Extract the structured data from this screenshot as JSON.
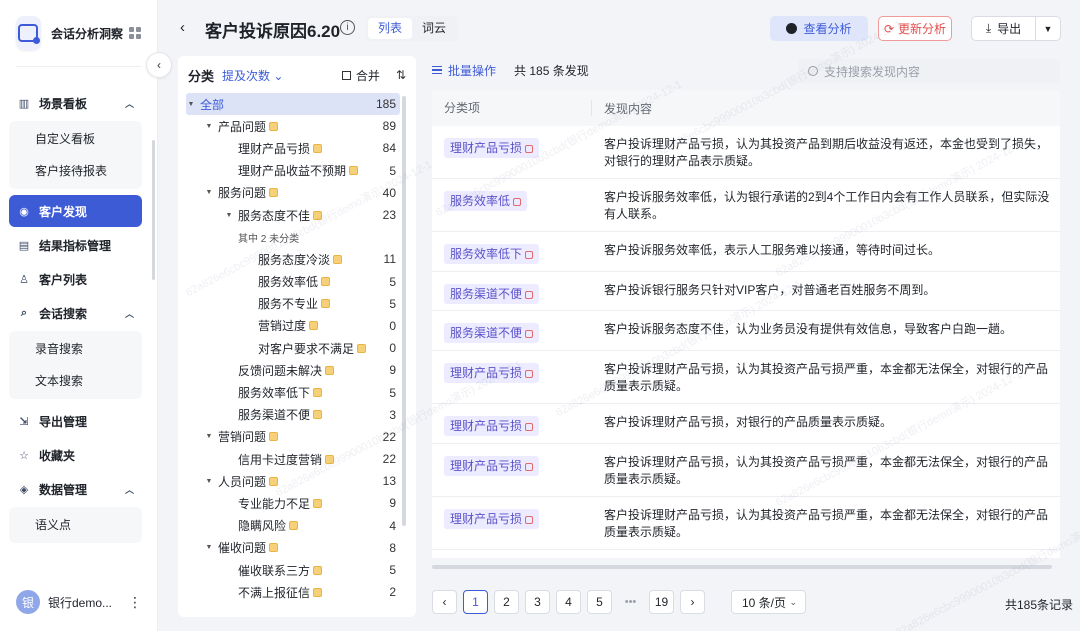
{
  "brand": {
    "name": "会话分析洞察"
  },
  "sidebar": {
    "groups": [
      {
        "label": "场景看板",
        "icon": "chart-icon",
        "expanded": true,
        "children": [
          "自定义看板",
          "客户接待报表"
        ]
      },
      {
        "label": "客户发现",
        "icon": "discovery-icon",
        "active": true
      },
      {
        "label": "结果指标管理",
        "icon": "doc-icon"
      },
      {
        "label": "客户列表",
        "icon": "user-icon"
      },
      {
        "label": "会话搜索",
        "icon": "search-doc-icon",
        "expanded": true,
        "children": [
          "录音搜索",
          "文本搜索"
        ]
      },
      {
        "label": "导出管理",
        "icon": "export-icon"
      },
      {
        "label": "收藏夹",
        "icon": "star-icon"
      },
      {
        "label": "数据管理",
        "icon": "layers-icon",
        "expanded": true,
        "children": [
          "语义点"
        ]
      }
    ],
    "user": {
      "avatar": "银",
      "name": "银行demo..."
    }
  },
  "header": {
    "title": "客户投诉原因6.20",
    "tabs": [
      "列表",
      "词云"
    ],
    "active_tab": "列表",
    "analyze": "查看分析",
    "update": "更新分析",
    "export": "导出"
  },
  "category": {
    "title": "分类",
    "sort": "提及次数",
    "merge": "合并",
    "tree": [
      {
        "label": "全部",
        "count": "185",
        "level": 0,
        "caret": "▼",
        "selected": true
      },
      {
        "label": "产品问题",
        "count": "89",
        "level": 1,
        "caret": "▼",
        "crown": true
      },
      {
        "label": "理财产品亏损",
        "count": "84",
        "level": 2,
        "crown": true
      },
      {
        "label": "理财产品收益不预期",
        "count": "5",
        "level": 2,
        "crown": true
      },
      {
        "label": "服务问题",
        "count": "40",
        "level": 1,
        "caret": "▼",
        "crown": true
      },
      {
        "label": "服务态度不佳",
        "count": "23",
        "level": 2,
        "caret": "▼",
        "crown": true
      },
      {
        "label": "其中 2 未分类",
        "count": "",
        "level": 2,
        "note": true
      },
      {
        "label": "服务态度冷淡",
        "count": "11",
        "level": 3,
        "crown": true
      },
      {
        "label": "服务效率低",
        "count": "5",
        "level": 3,
        "crown": true
      },
      {
        "label": "服务不专业",
        "count": "5",
        "level": 3,
        "crown": true
      },
      {
        "label": "营销过度",
        "count": "0",
        "level": 3,
        "crown": true
      },
      {
        "label": "对客户要求不满足",
        "count": "0",
        "level": 3,
        "crown": true
      },
      {
        "label": "反馈问题未解决",
        "count": "9",
        "level": 2,
        "crown": true
      },
      {
        "label": "服务效率低下",
        "count": "5",
        "level": 2,
        "crown": true
      },
      {
        "label": "服务渠道不便",
        "count": "3",
        "level": 2,
        "crown": true
      },
      {
        "label": "营销问题",
        "count": "22",
        "level": 1,
        "caret": "▼",
        "crown": true
      },
      {
        "label": "信用卡过度营销",
        "count": "22",
        "level": 2,
        "crown": true
      },
      {
        "label": "人员问题",
        "count": "13",
        "level": 1,
        "caret": "▼",
        "crown": true
      },
      {
        "label": "专业能力不足",
        "count": "9",
        "level": 2,
        "crown": true
      },
      {
        "label": "隐瞒风险",
        "count": "4",
        "level": 2,
        "crown": true
      },
      {
        "label": "催收问题",
        "count": "8",
        "level": 1,
        "caret": "▼",
        "crown": true
      },
      {
        "label": "催收联系三方",
        "count": "5",
        "level": 2,
        "crown": true
      },
      {
        "label": "不满上报征信",
        "count": "2",
        "level": 2,
        "crown": true
      }
    ]
  },
  "content": {
    "batch": "批量操作",
    "found": "共 185 条发现",
    "search_placeholder": "支持搜索发现内容",
    "columns": [
      "分类项",
      "发现内容"
    ],
    "rows": [
      {
        "tag": "理财产品亏损",
        "text": "客户投诉理财产品亏损，认为其投资产品到期后收益没有返还，本金也受到了损失，对银行的理财产品表示质疑。",
        "h": 53
      },
      {
        "tag": "服务效率低",
        "text": "客户投诉服务效率低，认为银行承诺的2到4个工作日内会有工作人员联系，但实际没有人联系。",
        "h": 53
      },
      {
        "tag": "服务效率低下",
        "text": "客户投诉服务效率低，表示人工服务难以接通，等待时间过长。",
        "h": 40
      },
      {
        "tag": "服务渠道不便",
        "text": "客户投诉银行服务只针对VIP客户，对普通老百姓服务不周到。",
        "h": 39
      },
      {
        "tag": "服务渠道不便",
        "text": "客户投诉服务态度不佳，认为业务员没有提供有效信息，导致客户白跑一趟。",
        "h": 40
      },
      {
        "tag": "理财产品亏损",
        "text": "客户投诉理财产品亏损，认为其投资产品亏损严重，本金都无法保全，对银行的产品质量表示质疑。",
        "h": 53
      },
      {
        "tag": "理财产品亏损",
        "text": "客户投诉理财产品亏损，对银行的产品质量表示质疑。",
        "h": 40
      },
      {
        "tag": "理财产品亏损",
        "text": "客户投诉理财产品亏损，认为其投资产品亏损严重，本金都无法保全，对银行的产品质量表示质疑。",
        "h": 53
      },
      {
        "tag": "理财产品亏损",
        "text": "客户投诉理财产品亏损，认为其投资产品亏损严重，本金都无法保全，对银行的产品质量表示质疑。",
        "h": 53
      }
    ]
  },
  "pager": {
    "pages": [
      "1",
      "2",
      "3",
      "4",
      "5"
    ],
    "ellipsis": "•••",
    "last": "19",
    "current": "1",
    "size": "10 条/页",
    "total": "共185条记录"
  },
  "watermark": "62a826e6cbc99900010b3cbd(银行demo演示) 2024-12-1"
}
